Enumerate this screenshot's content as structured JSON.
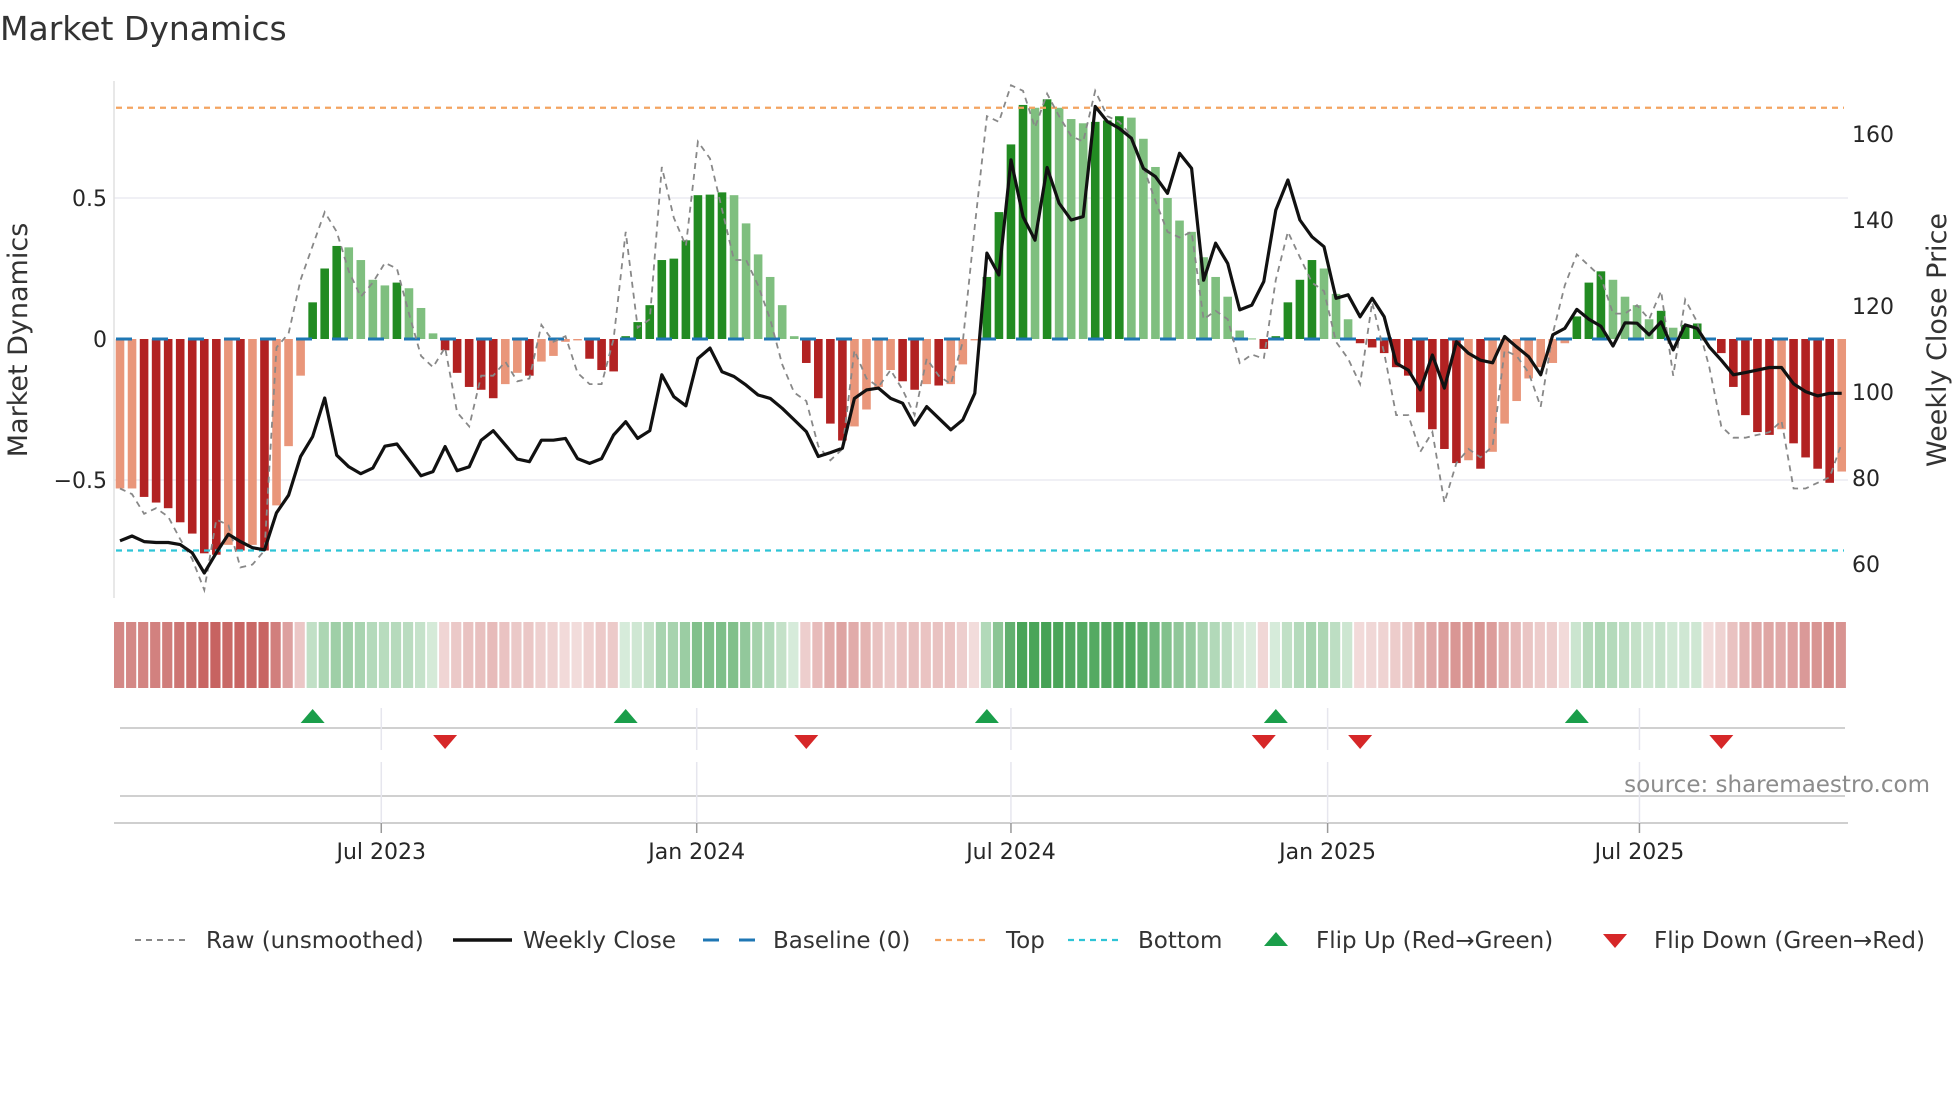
{
  "chart_data": {
    "type": "bar",
    "title": "Market Dynamics",
    "ylabel": "Market Dynamics",
    "y2label": "Weekly Close Price",
    "ylim": [
      -0.93,
      0.92
    ],
    "y2lim": [
      54.6,
      168.6
    ],
    "yticks": [
      {
        "value": 0.5,
        "label": "0.5"
      },
      {
        "value": 0,
        "label": "0"
      },
      {
        "value": -0.5,
        "label": "−0.5"
      }
    ],
    "y2ticks": [
      {
        "value": 160,
        "label": "160"
      },
      {
        "value": 140,
        "label": "140"
      },
      {
        "value": 120,
        "label": "120"
      },
      {
        "value": 100,
        "label": "100"
      },
      {
        "value": 80,
        "label": "80"
      },
      {
        "value": 60,
        "label": "60"
      }
    ],
    "x_unit": "week index",
    "xticks": [
      {
        "label": "Jul 2023",
        "week": 22.7
      },
      {
        "label": "Jan 2024",
        "week": 48.9
      },
      {
        "label": "Jul 2024",
        "week": 75.0
      },
      {
        "label": "Jan 2025",
        "week": 101.3
      },
      {
        "label": "Jul 2025",
        "week": 127.2
      }
    ],
    "grid": true,
    "thresholds": {
      "top": 0.82,
      "bottom": -0.75,
      "baseline": 0
    },
    "series": [
      {
        "name": "Market Dynamics (smoothed)",
        "type": "bar",
        "values": [
          -0.53,
          -0.53,
          -0.56,
          -0.58,
          -0.6,
          -0.65,
          -0.69,
          -0.76,
          -0.765,
          -0.73,
          -0.75,
          -0.73,
          -0.75,
          -0.59,
          -0.38,
          -0.13,
          0.13,
          0.25,
          0.33,
          0.325,
          0.28,
          0.21,
          0.19,
          0.2,
          0.18,
          0.11,
          0.02,
          -0.04,
          -0.12,
          -0.17,
          -0.18,
          -0.21,
          -0.16,
          -0.12,
          -0.13,
          -0.08,
          -0.06,
          -0.01,
          -0.005,
          -0.07,
          -0.11,
          -0.115,
          0.01,
          0.06,
          0.12,
          0.28,
          0.285,
          0.35,
          0.51,
          0.512,
          0.52,
          0.51,
          0.41,
          0.3,
          0.22,
          0.12,
          0.01,
          -0.085,
          -0.21,
          -0.3,
          -0.36,
          -0.31,
          -0.25,
          -0.17,
          -0.11,
          -0.15,
          -0.18,
          -0.16,
          -0.165,
          -0.16,
          -0.09,
          -0.005,
          0.22,
          0.45,
          0.69,
          0.83,
          0.82,
          0.85,
          0.82,
          0.78,
          0.765,
          0.77,
          0.775,
          0.79,
          0.785,
          0.71,
          0.61,
          0.5,
          0.42,
          0.38,
          0.29,
          0.22,
          0.15,
          0.03,
          0.002,
          -0.035,
          0.01,
          0.13,
          0.21,
          0.28,
          0.25,
          0.16,
          0.07,
          -0.015,
          -0.03,
          -0.05,
          -0.1,
          -0.13,
          -0.26,
          -0.32,
          -0.39,
          -0.44,
          -0.43,
          -0.46,
          -0.4,
          -0.3,
          -0.22,
          -0.14,
          -0.1,
          -0.085,
          -0.015,
          0.08,
          0.2,
          0.24,
          0.21,
          0.15,
          0.12,
          0.07,
          0.1,
          0.04,
          0.05,
          0.055,
          -0.002,
          -0.05,
          -0.17,
          -0.27,
          -0.33,
          -0.34,
          -0.32,
          -0.37,
          -0.42,
          -0.46,
          -0.51,
          -0.47
        ]
      },
      {
        "name": "Raw (unsmoothed)",
        "type": "line",
        "values": [
          -0.53,
          -0.55,
          -0.62,
          -0.6,
          -0.63,
          -0.71,
          -0.78,
          -0.89,
          -0.64,
          -0.66,
          -0.81,
          -0.8,
          -0.75,
          -0.03,
          0.02,
          0.21,
          0.33,
          0.45,
          0.38,
          0.24,
          0.15,
          0.2,
          0.27,
          0.25,
          0.09,
          -0.06,
          -0.1,
          -0.03,
          -0.26,
          -0.31,
          -0.13,
          -0.13,
          -0.08,
          -0.15,
          -0.14,
          0.05,
          -0.01,
          0.01,
          -0.12,
          -0.16,
          -0.16,
          0.0,
          0.38,
          0.04,
          0.07,
          0.61,
          0.43,
          0.33,
          0.7,
          0.64,
          0.46,
          0.28,
          0.28,
          0.19,
          0.07,
          -0.09,
          -0.19,
          -0.22,
          -0.38,
          -0.43,
          -0.39,
          -0.04,
          -0.14,
          -0.17,
          -0.11,
          -0.18,
          -0.27,
          -0.07,
          -0.13,
          -0.16,
          -0.01,
          0.4,
          0.79,
          0.77,
          0.9,
          0.88,
          0.75,
          0.87,
          0.79,
          0.72,
          0.7,
          0.88,
          0.79,
          0.77,
          0.72,
          0.61,
          0.49,
          0.38,
          0.36,
          0.38,
          0.07,
          0.1,
          0.07,
          -0.085,
          -0.055,
          -0.07,
          0.21,
          0.38,
          0.29,
          0.2,
          0.17,
          -0.01,
          -0.07,
          -0.16,
          0.13,
          -0.05,
          -0.27,
          -0.27,
          -0.4,
          -0.33,
          -0.58,
          -0.44,
          -0.39,
          -0.42,
          -0.38,
          -0.04,
          -0.06,
          -0.12,
          -0.24,
          0.02,
          0.19,
          0.3,
          0.26,
          0.22,
          0.09,
          0.09,
          0.12,
          0.07,
          0.17,
          -0.13,
          0.14,
          0.06,
          -0.1,
          -0.31,
          -0.35,
          -0.35,
          -0.34,
          -0.33,
          -0.29,
          -0.53,
          -0.53,
          -0.51,
          -0.49,
          -0.37
        ]
      },
      {
        "name": "Weekly Close",
        "type": "line",
        "axis": "right",
        "values": [
          65.4,
          66.5,
          65.2,
          65.0,
          65.0,
          64.5,
          62.6,
          57.9,
          62.6,
          66.9,
          65.2,
          63.8,
          63.3,
          71.9,
          76.0,
          85.0,
          89.6,
          98.6,
          85.3,
          82.6,
          81.0,
          82.3,
          87.4,
          87.9,
          84.2,
          80.5,
          81.5,
          87.3,
          81.7,
          82.6,
          88.8,
          91.0,
          87.7,
          84.4,
          83.8,
          88.8,
          88.8,
          89.2,
          84.5,
          83.4,
          84.5,
          90.0,
          93.1,
          89.2,
          91.0,
          104.0,
          98.9,
          96.8,
          107.8,
          110.2,
          104.7,
          103.6,
          101.6,
          99.3,
          98.5,
          96.2,
          93.5,
          90.8,
          85.0,
          85.9,
          86.9,
          98.5,
          100.5,
          100.9,
          98.5,
          97.4,
          92.3,
          96.6,
          93.9,
          91.2,
          93.5,
          99.7,
          132.3,
          127.2,
          154.0,
          140.8,
          135.3,
          152.2,
          143.9,
          140.0,
          140.8,
          166.4,
          162.9,
          161.3,
          159.0,
          152.0,
          150.1,
          146.2,
          155.5,
          152.0,
          126.0,
          134.6,
          129.9,
          119.1,
          120.2,
          125.7,
          142.3,
          149.3,
          140.0,
          136.1,
          133.8,
          121.8,
          122.6,
          117.5,
          121.8,
          117.5,
          106.7,
          105.1,
          100.5,
          108.6,
          100.9,
          111.7,
          109.0,
          107.4,
          106.8,
          112.9,
          110.5,
          108.2,
          104.0,
          113.3,
          114.8,
          119.2,
          116.9,
          115.3,
          110.7,
          116.1,
          116.0,
          113.3,
          116.3,
          109.8,
          115.6,
          114.8,
          110.5,
          107.4,
          104.0,
          104.5,
          105.1,
          105.7,
          105.7,
          101.9,
          100.1,
          99.1,
          99.7,
          99.7
        ]
      }
    ],
    "flips": {
      "up_weeks": [
        17,
        43,
        73,
        97,
        122
      ],
      "down_weeks": [
        28,
        58,
        96,
        104,
        134
      ]
    },
    "legend": {
      "placement": "bottom",
      "entries": [
        {
          "key": "raw",
          "label": "Raw (unsmoothed)"
        },
        {
          "key": "close",
          "label": "Weekly Close"
        },
        {
          "key": "baseline",
          "label": "Baseline (0)"
        },
        {
          "key": "top",
          "label": "Top"
        },
        {
          "key": "bottom",
          "label": "Bottom"
        },
        {
          "key": "flip_up",
          "label": "Flip Up (Red→Green)"
        },
        {
          "key": "flip_down",
          "label": "Flip Down (Green→Red)"
        }
      ]
    },
    "source": "source: sharemaestro.com"
  },
  "colors": {
    "red_strong": "#b22222",
    "red_weak": "#e9967a",
    "green_strong": "#228b22",
    "green_weak": "#7fbf7f",
    "raw": "#888888",
    "close": "#111111",
    "baseline": "#1f77b4",
    "top": "#f4a460",
    "bottom": "#2ec4d6",
    "flip_up": "#1a9e4a",
    "flip_down": "#d62728",
    "strip_green": "#3f9f4f",
    "strip_red": "#c0504d"
  }
}
